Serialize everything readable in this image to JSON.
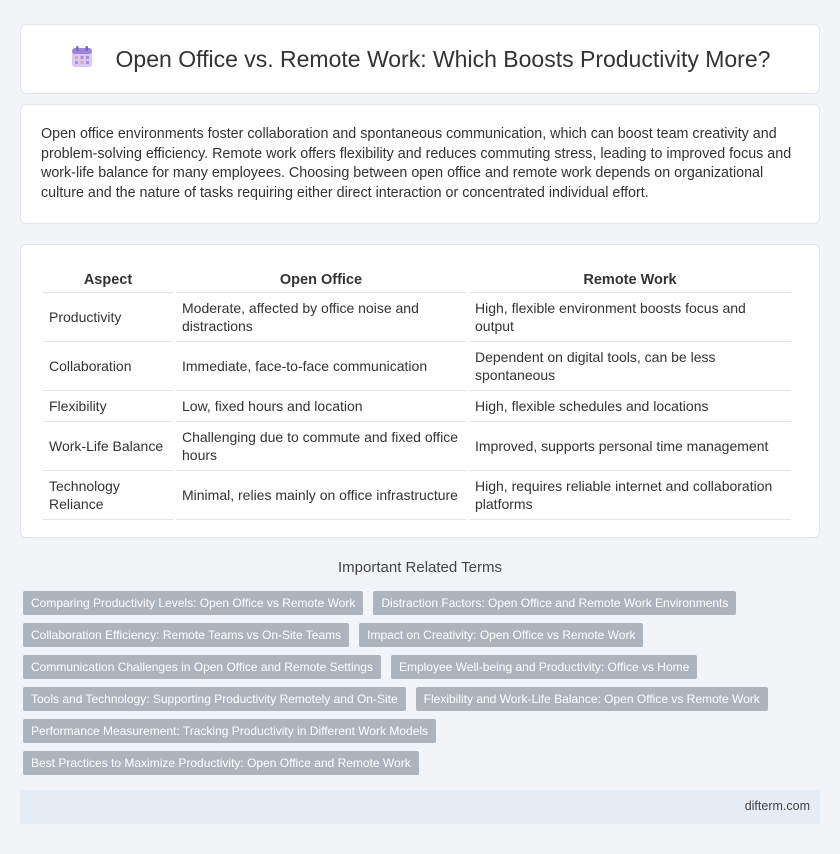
{
  "header": {
    "title": "Open Office vs. Remote Work: Which Boosts Productivity More?",
    "icon": "calendar-icon"
  },
  "intro": {
    "text": "Open office environments foster collaboration and spontaneous communication, which can boost team creativity and problem-solving efficiency. Remote work offers flexibility and reduces commuting stress, leading to improved focus and work-life balance for many employees. Choosing between open office and remote work depends on organizational culture and the nature of tasks requiring either direct interaction or concentrated individual effort."
  },
  "table": {
    "headers": [
      "Aspect",
      "Open Office",
      "Remote Work"
    ],
    "rows": [
      [
        "Productivity",
        "Moderate, affected by office noise and distractions",
        "High, flexible environment boosts focus and output"
      ],
      [
        "Collaboration",
        "Immediate, face-to-face communication",
        "Dependent on digital tools, can be less spontaneous"
      ],
      [
        "Flexibility",
        "Low, fixed hours and location",
        "High, flexible schedules and locations"
      ],
      [
        "Work-Life Balance",
        "Challenging due to commute and fixed office hours",
        "Improved, supports personal time management"
      ],
      [
        "Technology Reliance",
        "Minimal, relies mainly on office infrastructure",
        "High, requires reliable internet and collaboration platforms"
      ]
    ]
  },
  "related": {
    "title": "Important Related Terms",
    "rows": [
      [
        "Comparing Productivity Levels: Open Office vs Remote Work",
        "Distraction Factors: Open Office and Remote Work Environments"
      ],
      [
        "Collaboration Efficiency: Remote Teams vs On-Site Teams",
        "Impact on Creativity: Open Office vs Remote Work"
      ],
      [
        "Communication Challenges in Open Office and Remote Settings",
        "Employee Well-being and Productivity: Office vs Home"
      ],
      [
        "Tools and Technology: Supporting Productivity Remotely and On-Site",
        "Flexibility and Work-Life Balance: Open Office vs Remote Work"
      ],
      [
        "Performance Measurement: Tracking Productivity in Different Work Models"
      ],
      [
        "Best Practices to Maximize Productivity: Open Office and Remote Work"
      ]
    ]
  },
  "footer": {
    "site": "difterm.com"
  }
}
